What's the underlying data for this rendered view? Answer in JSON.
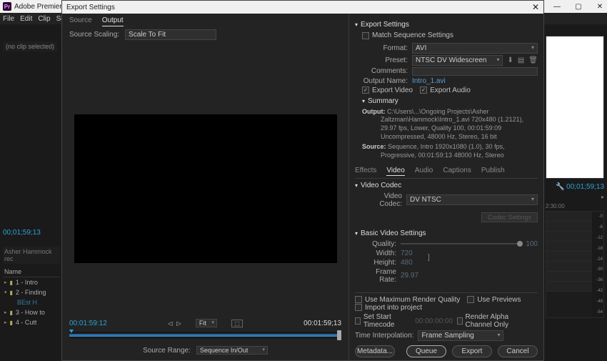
{
  "app": {
    "title": "Adobe Premiere Pro CC",
    "icon_text": "Pr",
    "menu": [
      "File",
      "Edit",
      "Clip",
      "Sequen"
    ]
  },
  "dialog": {
    "title": "Export Settings",
    "left": {
      "tabs": {
        "source": "Source",
        "output": "Output"
      },
      "scale_label": "Source Scaling:",
      "scale_value": "Scale To Fit",
      "in_tc": "00:01:59:12",
      "out_tc": "00:01:59;13",
      "fit": "Fit",
      "src_range_label": "Source Range:",
      "src_range_value": "Sequence In/Out"
    },
    "right": {
      "section_export": "Export Settings",
      "match_seq": "Match Sequence Settings",
      "format_label": "Format:",
      "format_value": "AVI",
      "preset_label": "Preset:",
      "preset_value": "NTSC DV Widescreen",
      "comments_label": "Comments:",
      "outputname_label": "Output Name:",
      "outputname_value": "Intro_1.avi",
      "export_video": "Export Video",
      "export_audio": "Export Audio",
      "summary_head": "Summary",
      "summary_output_lbl": "Output:",
      "summary_output_val": "C:\\Users\\...\\Ongoing Projects\\Asher Zaltzman\\Hammock\\Intro_1.avi 720x480 (1.2121), 29.97 fps, Lower, Quality 100, 00:01:59:09 Uncompressed, 48000 Hz, Stereo, 16 bit",
      "summary_source_lbl": "Source:",
      "summary_source_val": "Sequence, Intro 1920x1080 (1.0), 30 fps, Progressive, 00:01:59:13 48000 Hz, Stereo",
      "tabs": [
        "Effects",
        "Video",
        "Audio",
        "Captions",
        "Publish"
      ],
      "codec_head": "Video Codec",
      "codec_label": "Video Codec:",
      "codec_value": "DV NTSC",
      "codec_btn": "Codec Settings",
      "basic_head": "Basic Video Settings",
      "quality_label": "Quality:",
      "quality_value": "100",
      "width_label": "Width:",
      "width_value": "720",
      "height_label": "Height:",
      "height_value": "480",
      "fps_label": "Frame Rate:",
      "fps_value": "29.97",
      "opts": {
        "max_render": "Use Maximum Render Quality",
        "previews": "Use Previews",
        "import_proj": "Import into project",
        "start_tc_lbl": "Set Start Timecode",
        "start_tc_val": "00:00:00:00",
        "alpha": "Render Alpha Channel Only",
        "time_interp_lbl": "Time Interpolation:",
        "time_interp_val": "Frame Sampling"
      },
      "buttons": {
        "metadata": "Metadata...",
        "queue": "Queue",
        "export": "Export",
        "cancel": "Cancel"
      }
    }
  },
  "bg": {
    "noclip": "(no clip selected)",
    "tc": "00;01;59;13",
    "panel_label": "Asher Hammock rec",
    "name_col": "Name",
    "items": [
      "1 - Intro",
      "2 - Finding",
      "BEst H",
      "3 - How to",
      "4 - Cutt"
    ],
    "right_tc": "00;01;59;13",
    "timeline_time": "2:30:00"
  }
}
